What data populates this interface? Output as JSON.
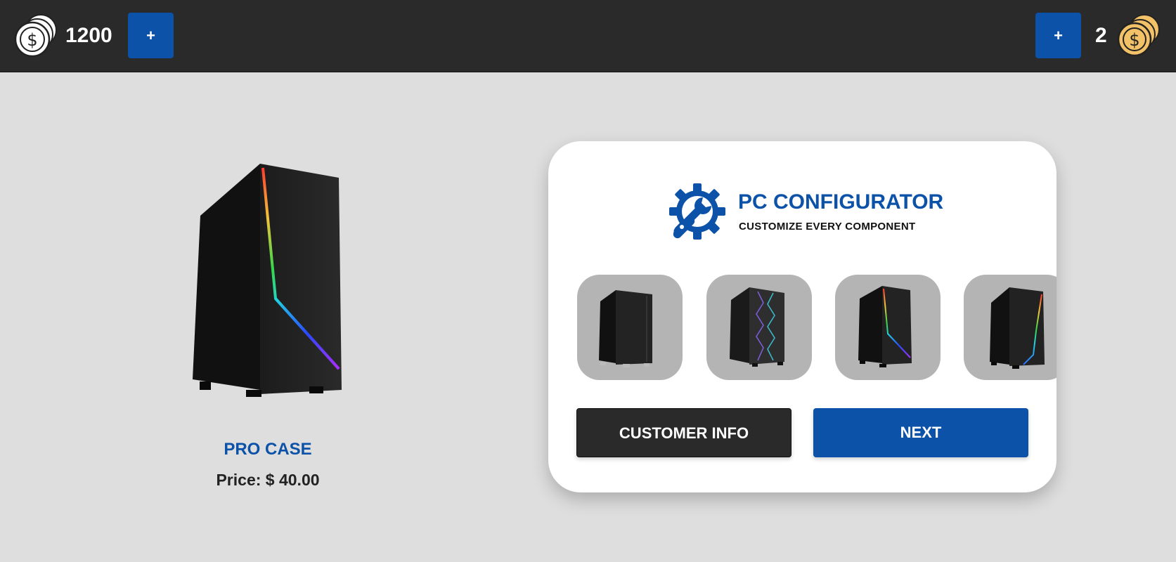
{
  "header": {
    "left_currency": {
      "amount": "1200",
      "icon": "silver-coin-stack-icon",
      "add_label": "+"
    },
    "right_currency": {
      "amount": "2",
      "icon": "gold-coin-stack-icon",
      "add_label": "+"
    }
  },
  "product": {
    "image_icon": "pc-case-image",
    "name": "PRO CASE",
    "price": "Price: $ 40.00"
  },
  "configurator": {
    "logo_icon": "gear-wrench-icon",
    "title": "PC CONFIGURATOR",
    "subtitle": "CUSTOMIZE EVERY COMPONENT",
    "options": [
      {
        "icon": "basic-case-thumbnail"
      },
      {
        "icon": "rgb-mesh-case-thumbnail"
      },
      {
        "icon": "pro-case-thumbnail"
      },
      {
        "icon": "rgb-stripe-case-thumbnail"
      }
    ],
    "customer_info_label": "CUSTOMER INFO",
    "next_label": "NEXT"
  },
  "colors": {
    "topbar": "#2a2a2a",
    "accent_blue": "#0b52a8",
    "background": "#dedede",
    "gold_coin": "#f3c167"
  }
}
